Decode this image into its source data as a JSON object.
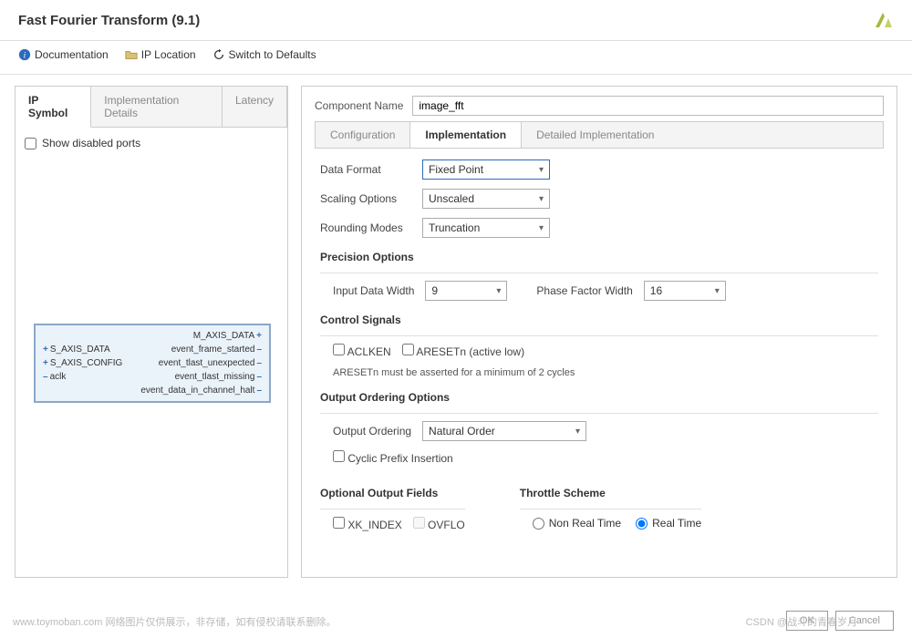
{
  "header": {
    "title": "Fast Fourier Transform (9.1)"
  },
  "toolbar": {
    "documentation": "Documentation",
    "ip_location": "IP Location",
    "switch_defaults": "Switch to Defaults"
  },
  "left": {
    "tabs": [
      "IP Symbol",
      "Implementation Details",
      "Latency"
    ],
    "active_tab": 0,
    "show_disabled_ports_label": "Show disabled ports",
    "ip_block": {
      "left_ports": [
        "S_AXIS_DATA",
        "S_AXIS_CONFIG",
        "aclk"
      ],
      "right_ports": [
        "M_AXIS_DATA",
        "event_frame_started",
        "event_tlast_unexpected",
        "event_tlast_missing",
        "event_data_in_channel_halt"
      ]
    }
  },
  "right": {
    "component_name_label": "Component Name",
    "component_name_value": "image_fft",
    "tabs": [
      "Configuration",
      "Implementation",
      "Detailed Implementation"
    ],
    "active_tab": 1,
    "fields": {
      "data_format": {
        "label": "Data Format",
        "value": "Fixed Point"
      },
      "scaling_options": {
        "label": "Scaling Options",
        "value": "Unscaled"
      },
      "rounding_modes": {
        "label": "Rounding Modes",
        "value": "Truncation"
      }
    },
    "precision": {
      "title": "Precision Options",
      "input_width_label": "Input Data Width",
      "input_width_value": "9",
      "phase_width_label": "Phase Factor Width",
      "phase_width_value": "16"
    },
    "control": {
      "title": "Control Signals",
      "aclken": "ACLKEN",
      "aresetn": "ARESETn (active low)",
      "note": "ARESETn must be asserted for a minimum of 2 cycles"
    },
    "output_ordering": {
      "title": "Output Ordering Options",
      "label": "Output Ordering",
      "value": "Natural Order",
      "cyclic_prefix": "Cyclic Prefix Insertion"
    },
    "optional_fields": {
      "title": "Optional Output Fields",
      "xk_index": "XK_INDEX",
      "ovflo": "OVFLO"
    },
    "throttle": {
      "title": "Throttle Scheme",
      "non_real": "Non Real Time",
      "real": "Real Time",
      "selected": "real"
    }
  },
  "buttons": {
    "ok": "OK",
    "cancel": "Cancel"
  },
  "watermarks": {
    "left": "www.toymoban.com  网络图片仅供展示，非存储，如有侵权请联系删除。",
    "right": "CSDN @战斗的青春岁月"
  }
}
